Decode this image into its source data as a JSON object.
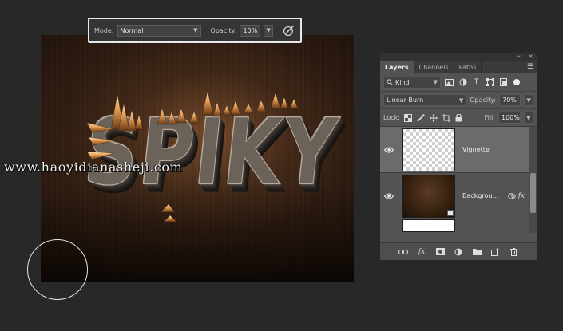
{
  "options_bar": {
    "mode_label": "Mode:",
    "mode_value": "Normal",
    "opacity_label": "Opacity:",
    "opacity_value": "10%",
    "airbrush_icon": "airbrush-icon"
  },
  "artwork": {
    "title_text": "SPIKY",
    "watermark": "www.haoyidianasheji.com"
  },
  "layers_panel": {
    "tabs": [
      {
        "label": "Layers",
        "active": true
      },
      {
        "label": "Channels",
        "active": false
      },
      {
        "label": "Paths",
        "active": false
      }
    ],
    "filter": {
      "kind_label": "Kind"
    },
    "blend_mode": "Linear Burn",
    "opacity_label": "Opacity:",
    "opacity_value": "70%",
    "lock_label": "Lock:",
    "fill_label": "Fill:",
    "fill_value": "100%",
    "layers": [
      {
        "name": "Vignette",
        "selected": true,
        "visible": true
      },
      {
        "name": "Backgrou...",
        "selected": false,
        "visible": true,
        "has_fx": true,
        "fx_label": "fx"
      }
    ]
  },
  "colors": {
    "app_bg": "#282828",
    "panel_bg": "#535353",
    "selected_row": "#6b6b6b",
    "highlight_border": "#e9e9e9"
  }
}
